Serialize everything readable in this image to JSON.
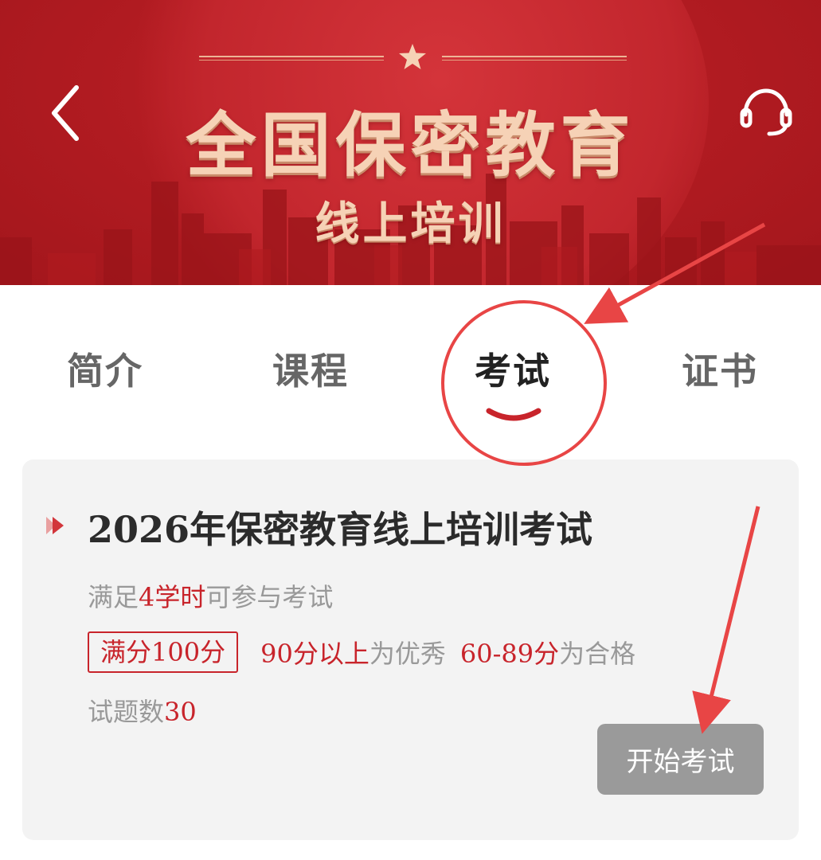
{
  "banner": {
    "title": "全国保密教育",
    "subtitle": "线上培训",
    "icons": [
      "back-chevron-icon",
      "star-icon",
      "headset-icon"
    ]
  },
  "tabs": [
    {
      "label": "简介",
      "active": false
    },
    {
      "label": "课程",
      "active": false
    },
    {
      "label": "考试",
      "active": true
    },
    {
      "label": "证书",
      "active": false
    }
  ],
  "exam": {
    "title": "2026年保密教育线上培训考试",
    "req_prefix": "满足",
    "req_hours": "4学时",
    "req_suffix": "可参与考试",
    "full_score": "满分100分",
    "excellent_range": "90分以上",
    "excellent_label": "为优秀",
    "pass_range": "60-89分",
    "pass_label": "为合格",
    "count_label": "试题数",
    "count_value": "30",
    "start_button": "开始考试"
  },
  "colors": {
    "brand_red": "#c8242b",
    "annotation_red": "#e84545",
    "button_gray": "#9a9a9a",
    "card_bg": "#f3f3f3"
  }
}
